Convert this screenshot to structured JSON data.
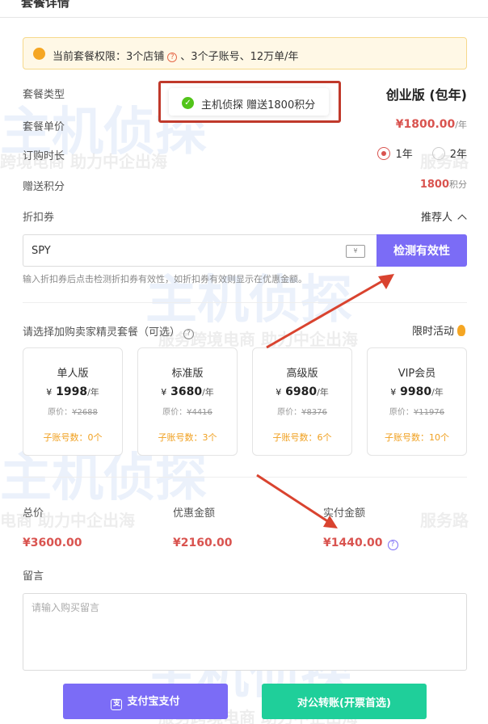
{
  "header": {
    "title": "套餐详情"
  },
  "notice": {
    "prefix": "当前套餐权限：",
    "stores": "3个店铺",
    "help": "?",
    "rest": "、3个子账号、12万单/年"
  },
  "plan": {
    "type_label": "套餐类型",
    "type_value": "创业版 (包年)",
    "price_label": "套餐单价",
    "price_value": "¥1800.00",
    "price_unit": "/年",
    "duration_label": "订购时长",
    "duration_options": [
      {
        "label": "1年",
        "selected": true
      },
      {
        "label": "2年",
        "selected": false
      }
    ],
    "points_label": "赠送积分",
    "points_value": "1800",
    "points_unit": "积分"
  },
  "toast": {
    "icon": "check-circle-icon",
    "message": "主机侦探 赠送1800积分"
  },
  "coupon": {
    "label": "折扣券",
    "referrer": "推荐人",
    "value": "SPY",
    "ticket_glyph": "¥",
    "button": "检测有效性",
    "hint": "输入折扣券后点击检测折扣券有效性，如折扣券有效则显示在优惠金额。"
  },
  "addons": {
    "title": "请选择加购卖家精灵套餐（可选）",
    "help": "?",
    "limited": "限时活动",
    "tiers": [
      {
        "name": "单人版",
        "currency": "¥",
        "price": "1998",
        "per": "/年",
        "orig_label": "原价：",
        "orig": "¥2688",
        "accounts": "子账号数：0个"
      },
      {
        "name": "标准版",
        "currency": "¥",
        "price": "3680",
        "per": "/年",
        "orig_label": "原价：",
        "orig": "¥4416",
        "accounts": "子账号数：3个"
      },
      {
        "name": "高级版",
        "currency": "¥",
        "price": "6980",
        "per": "/年",
        "orig_label": "原价：",
        "orig": "¥8376",
        "accounts": "子账号数：6个"
      },
      {
        "name": "VIP会员",
        "currency": "¥",
        "price": "9980",
        "per": "/年",
        "orig_label": "原价：",
        "orig": "¥11976",
        "accounts": "子账号数：10个"
      }
    ]
  },
  "totals": {
    "total_label": "总价",
    "total_value": "¥3600.00",
    "discount_label": "优惠金额",
    "discount_value": "¥2160.00",
    "paid_label": "实付金额",
    "paid_value": "¥1440.00",
    "help": "?"
  },
  "message": {
    "label": "留言",
    "placeholder": "请输入购买留言"
  },
  "actions": {
    "alipay_glyph": "支",
    "alipay": "支付宝支付",
    "bank": "对公转账(开票首选)"
  },
  "watermark": {
    "brand": "主机侦探",
    "slogan": "服务跨境电商 助力中企出海",
    "slogan_short": "跨境电商 助力中企出海",
    "slogan_tail": "服务路",
    "slogan_mid": "电商 助力中企出海"
  },
  "colors": {
    "accent": "#7b6cf6",
    "price": "#d9534f",
    "success": "#1fcf9a",
    "warning": "#f5a623"
  }
}
